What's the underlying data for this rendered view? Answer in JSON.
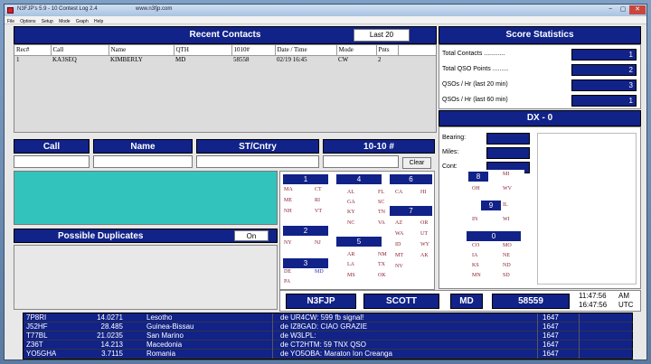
{
  "window": {
    "title": "N3FJP's 5.9 - 10 Contest Log 2.4",
    "url": "www.n3fjp.com",
    "controls": [
      "−",
      "▢",
      "✕"
    ]
  },
  "menu": [
    "File",
    "Options",
    "Setup",
    "Mode",
    "Graph",
    "Help"
  ],
  "recent": {
    "title": "Recent Contacts",
    "last_button": "Last 20",
    "columns": [
      "Rec#",
      "Call",
      "Name",
      "QTH",
      "1010#",
      "Date / Time",
      "Mode",
      "Pnts"
    ],
    "rows": [
      [
        "1",
        "KA3SEQ",
        "KIMBERLY",
        "MD",
        "58558",
        "02/19 16:45",
        "CW",
        "2"
      ]
    ]
  },
  "score": {
    "title": "Score Statistics",
    "items": [
      {
        "label": "Total Contacts ............",
        "value": "1"
      },
      {
        "label": "Total QSO Points .........",
        "value": "2"
      },
      {
        "label": "QSOs / Hr (last 20 min)",
        "value": "3"
      },
      {
        "label": "QSOs / Hr (last 60 min)",
        "value": "1"
      }
    ]
  },
  "dx": {
    "title": "DX - 0",
    "bearing_label": "Bearing:",
    "miles_label": "Miles:",
    "cont_label": "Cont:"
  },
  "entry": {
    "call": "Call",
    "name": "Name",
    "stcntry": "ST/Cntry",
    "ten": "10-10 #",
    "clear": "Clear"
  },
  "dups": {
    "title": "Possible Duplicates",
    "toggle": "On"
  },
  "zones": [
    {
      "num": "1",
      "states": [
        [
          "MA",
          "CT"
        ],
        [
          "ME",
          "RI"
        ],
        [
          "NH",
          "VT"
        ]
      ]
    },
    {
      "num": "2",
      "states": [
        [
          "NY",
          "NJ"
        ]
      ]
    },
    {
      "num": "3",
      "states": [
        [
          "DE",
          "MD"
        ],
        [
          "PA",
          ""
        ]
      ]
    },
    {
      "num": "4",
      "states": [
        [
          "AL",
          "FL"
        ],
        [
          "GA",
          "SC"
        ],
        [
          "KY",
          "TN"
        ],
        [
          "NC",
          "VA"
        ]
      ]
    },
    {
      "num": "5",
      "states": [
        [
          "AR",
          "NM"
        ],
        [
          "LA",
          "TX"
        ],
        [
          "MS",
          "OK"
        ]
      ]
    },
    {
      "num": "6",
      "states": [
        [
          "CA",
          "HI"
        ]
      ]
    },
    {
      "num": "7",
      "states": [
        [
          "AZ",
          "OR"
        ],
        [
          "WA",
          "UT"
        ],
        [
          "ID",
          "WY"
        ],
        [
          "MT",
          "AK"
        ],
        [
          "NV",
          ""
        ]
      ]
    },
    {
      "num": "8",
      "states": [
        [
          "MI",
          ""
        ],
        [
          "OH",
          "WV"
        ]
      ]
    },
    {
      "num": "9",
      "states": [
        [
          "IL",
          ""
        ],
        [
          "IN",
          "WI"
        ]
      ]
    },
    {
      "num": "0",
      "states": [
        [
          "CO",
          "MO"
        ],
        [
          "IA",
          "NE"
        ],
        [
          "KS",
          "ND"
        ],
        [
          "MN",
          "SD"
        ]
      ]
    }
  ],
  "station": {
    "call": "N3FJP",
    "name": "SCOTT",
    "qth": "MD",
    "number": "58559",
    "local_time": "11:47:56",
    "local_suffix": "AM",
    "utc_time": "16:47:56",
    "utc_suffix": "UTC"
  },
  "spots": [
    {
      "call": "7P8RI",
      "freq": "14.0271",
      "country": "Lesotho",
      "comment": "de UR4CW:  599 fb signal!",
      "time": "1647"
    },
    {
      "call": "J52HF",
      "freq": "28.485",
      "country": "Guinea-Bissau",
      "comment": "de IZ8GAD:  CIAO GRAZIE",
      "time": "1647"
    },
    {
      "call": "T77BL",
      "freq": "21.0235",
      "country": "San Marino",
      "comment": "de W3LPL:",
      "time": "1647"
    },
    {
      "call": "Z36T",
      "freq": "14.213",
      "country": "Macedonia",
      "comment": "de CT2HTM:  59 TNX QSO",
      "time": "1647"
    },
    {
      "call": "YO5GHA",
      "freq": "3.7115",
      "country": "Romania",
      "comment": "de YO5OBA:  Maraton Ion Creanga",
      "time": "1647"
    }
  ]
}
